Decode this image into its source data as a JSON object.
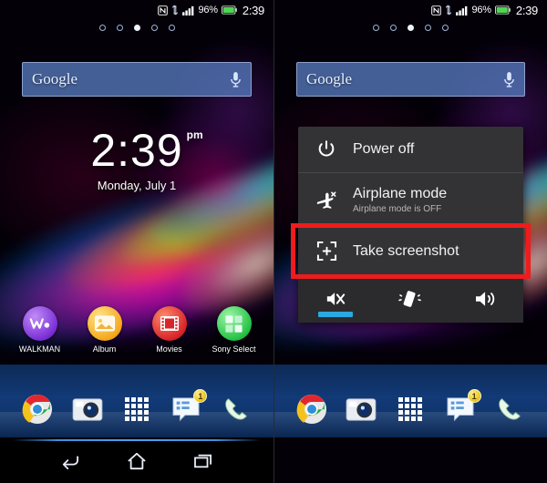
{
  "device": {
    "status_bar": {
      "icons": [
        "nfc-icon",
        "sync-icon",
        "signal-icon",
        "battery-icon"
      ],
      "battery_percent": "96%",
      "clock": "2:39"
    },
    "page_indicator": {
      "count": 5,
      "active_index": 2
    },
    "search_widget": {
      "label": "Google",
      "mic_icon": "microphone-icon",
      "placeholder": "Google"
    },
    "clock_widget": {
      "time": "2:39",
      "ampm": "pm",
      "date": "Monday, July 1"
    },
    "app_shortcuts": [
      {
        "label": "WALKMAN",
        "icon": "walkman-icon",
        "color": "#7b2fd6"
      },
      {
        "label": "Album",
        "icon": "album-icon",
        "color": "#f5a81c"
      },
      {
        "label": "Movies",
        "icon": "movies-icon",
        "color": "#d8252a"
      },
      {
        "label": "Sony Select",
        "icon": "sony-select-icon",
        "color": "#25c246"
      }
    ],
    "dock": [
      {
        "name": "chrome-icon",
        "label": "Chrome",
        "badge": ""
      },
      {
        "name": "camera-icon",
        "label": "Camera",
        "badge": ""
      },
      {
        "name": "app-drawer-icon",
        "label": "Apps",
        "badge": ""
      },
      {
        "name": "messaging-icon",
        "label": "Messaging",
        "badge": "1"
      },
      {
        "name": "phone-icon",
        "label": "Phone",
        "badge": ""
      }
    ],
    "navigation": [
      {
        "name": "back-button",
        "label": "Back"
      },
      {
        "name": "home-button",
        "label": "Home"
      },
      {
        "name": "recents-button",
        "label": "Recent apps"
      }
    ]
  },
  "power_menu": {
    "items": [
      {
        "icon": "power-icon",
        "title": "Power off",
        "subtitle": ""
      },
      {
        "icon": "airplane-icon",
        "title": "Airplane mode",
        "subtitle": "Airplane mode is OFF"
      },
      {
        "icon": "screenshot-icon",
        "title": "Take screenshot",
        "subtitle": ""
      }
    ],
    "sound_toggles": [
      {
        "icon": "mute-icon",
        "label": "Silent",
        "active": true
      },
      {
        "icon": "vibrate-icon",
        "label": "Vibrate",
        "active": false
      },
      {
        "icon": "speaker-icon",
        "label": "Sound on",
        "active": false
      }
    ],
    "highlight_color": "#ee1c1c",
    "highlighted_item_index": 2,
    "accent_color": "#2aa9e0"
  }
}
